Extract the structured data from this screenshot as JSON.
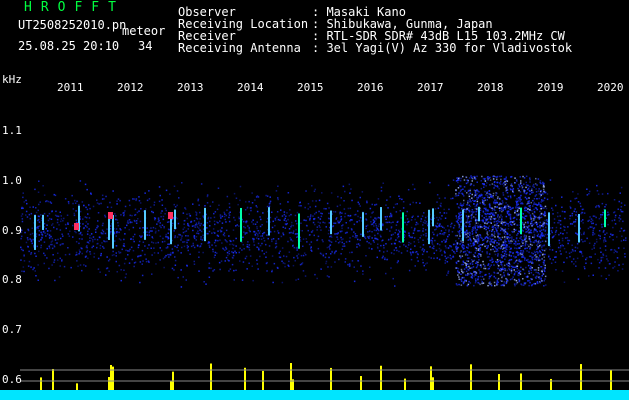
{
  "header": {
    "brand": "HROFFT",
    "filename": "UT2508252010.pn",
    "meteor_label": "meteor",
    "datetime": "25.08.25 20:10",
    "count": "34",
    "observer_label": "Observer",
    "observer_value": ": Masaki Kano",
    "location_label": "Receiving Location",
    "location_value": ": Shibukawa, Gunma, Japan",
    "receiver_label": "Receiver",
    "receiver_value": ": RTL-SDR SDR# 43dB L15 103.2MHz CW",
    "antenna_label": "Receiving Antenna",
    "antenna_value": ": 3el Yagi(V) Az 330 for Vladivostok"
  },
  "axis": {
    "y_unit": "kHz",
    "y_ticks": [
      "1.1",
      "1.0",
      "0.9",
      "0.8",
      "0.7",
      "0.6"
    ],
    "x_ticks": [
      "2011",
      "2012",
      "2013",
      "2014",
      "2015",
      "2016",
      "2017",
      "2018",
      "2019",
      "2020"
    ]
  },
  "colors": {
    "background": "#000000",
    "text": "#ffffff",
    "brand": "#00ff40",
    "spectrum": "#1a2fff",
    "count_bars": "#ffff00",
    "baseline": "#00e5ff"
  }
}
